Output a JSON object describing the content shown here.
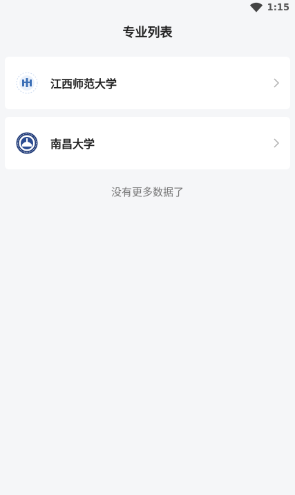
{
  "status_bar": {
    "time": "1:15",
    "wifi_icon": "wifi-icon"
  },
  "header": {
    "title": "专业列表"
  },
  "universities": [
    {
      "name": "江西师范大学",
      "logo_icon": "jxnu-logo-icon"
    },
    {
      "name": "南昌大学",
      "logo_icon": "ncu-logo-icon"
    }
  ],
  "footer": {
    "no_more_text": "没有更多数据了"
  },
  "colors": {
    "background": "#f5f6f8",
    "card": "#ffffff",
    "accent_logo_1": "#3b6fb6",
    "accent_logo_2": "#1f3a78"
  }
}
